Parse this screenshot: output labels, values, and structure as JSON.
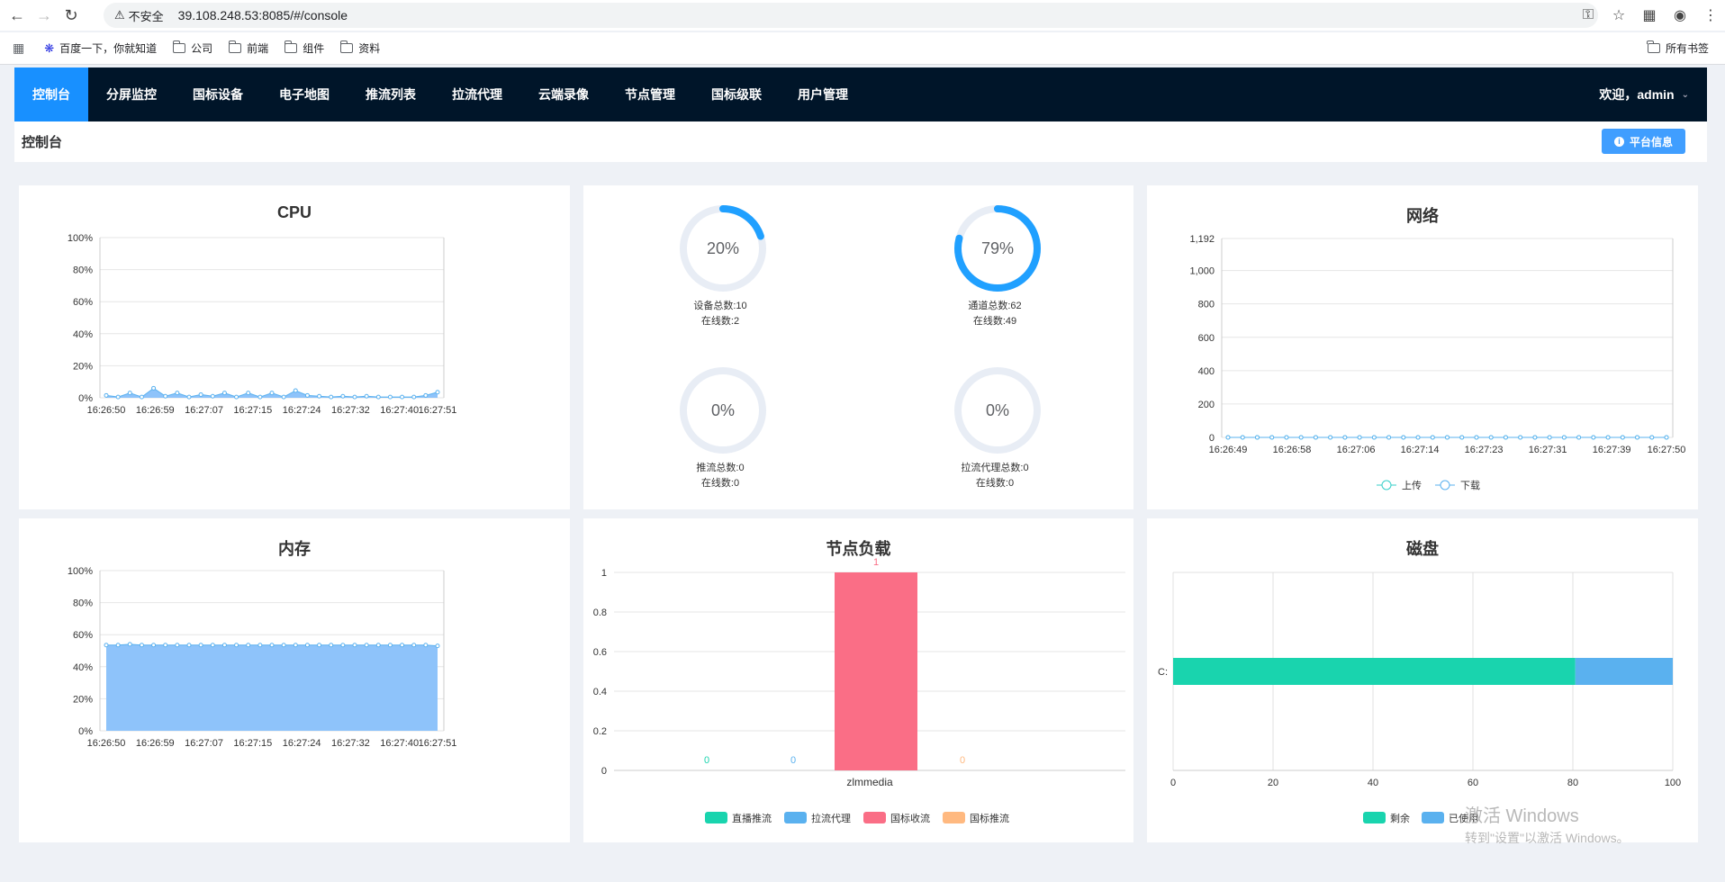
{
  "browser": {
    "security_label": "不安全",
    "url": "39.108.248.53:8085/#/console",
    "bookmarks": [
      "百度一下，你就知道",
      "公司",
      "前端",
      "组件",
      "资料"
    ],
    "all_bookmarks": "所有书签"
  },
  "nav": {
    "items": [
      "控制台",
      "分屏监控",
      "国标设备",
      "电子地图",
      "推流列表",
      "拉流代理",
      "云端录像",
      "节点管理",
      "国标级联",
      "用户管理"
    ],
    "active_index": 0,
    "welcome": "欢迎，admin"
  },
  "page": {
    "title": "控制台",
    "info_button": "平台信息"
  },
  "gauges": [
    {
      "percent_label": "20%",
      "fraction": 0.2,
      "line1": "设备总数:10",
      "line2": "在线数:2"
    },
    {
      "percent_label": "79%",
      "fraction": 0.79,
      "line1": "通道总数:62",
      "line2": "在线数:49"
    },
    {
      "percent_label": "0%",
      "fraction": 0,
      "line1": "推流总数:0",
      "line2": "在线数:0"
    },
    {
      "percent_label": "0%",
      "fraction": 0,
      "line1": "拉流代理总数:0",
      "line2": "在线数:0"
    }
  ],
  "chart_data": [
    {
      "id": "cpu",
      "type": "area",
      "title": "CPU",
      "yticks": [
        "0%",
        "20%",
        "40%",
        "60%",
        "80%",
        "100%"
      ],
      "ylim": [
        0,
        100
      ],
      "xticks": [
        "16:26:50",
        "16:26:59",
        "16:27:07",
        "16:27:15",
        "16:27:24",
        "16:27:32",
        "16:27:40",
        "16:27:51"
      ],
      "values": [
        1.5,
        0.5,
        3,
        0.5,
        6,
        1,
        3,
        0.5,
        2,
        1,
        3,
        0.5,
        3,
        0.5,
        3,
        0.5,
        4.5,
        1.5,
        1,
        0.5,
        1,
        0.5,
        1,
        0.5,
        0.5,
        0.5,
        0.5,
        1.5,
        3.5
      ],
      "grid": true
    },
    {
      "id": "network",
      "type": "line",
      "title": "网络",
      "yticks": [
        "0",
        "200",
        "400",
        "600",
        "800",
        "1,000",
        "1,192"
      ],
      "ylim": [
        0,
        1192
      ],
      "xticks": [
        "16:26:49",
        "16:26:58",
        "16:27:06",
        "16:27:14",
        "16:27:23",
        "16:27:31",
        "16:27:39",
        "16:27:50"
      ],
      "series": [
        {
          "name": "上传",
          "color": "#36cfc9",
          "values": [
            0,
            0,
            0,
            0,
            0,
            0,
            0,
            0,
            0,
            0,
            0,
            0,
            0,
            0,
            0,
            0,
            0,
            0,
            0,
            0,
            0,
            0,
            0,
            0,
            0,
            0,
            0,
            0,
            0,
            0,
            0
          ]
        },
        {
          "name": "下载",
          "color": "#5ab1ef",
          "values": [
            0,
            0,
            0,
            0,
            0,
            0,
            0,
            0,
            0,
            0,
            0,
            0,
            0,
            0,
            0,
            0,
            0,
            0,
            0,
            0,
            0,
            0,
            0,
            0,
            0,
            0,
            0,
            0,
            0,
            0,
            0
          ]
        }
      ],
      "legend_position": "bottom"
    },
    {
      "id": "memory",
      "type": "area",
      "title": "内存",
      "yticks": [
        "0%",
        "20%",
        "40%",
        "60%",
        "80%",
        "100%"
      ],
      "ylim": [
        0,
        100
      ],
      "xticks": [
        "16:26:50",
        "16:26:59",
        "16:27:07",
        "16:27:15",
        "16:27:24",
        "16:27:32",
        "16:27:40",
        "16:27:51"
      ],
      "values": [
        53.5,
        53.5,
        54,
        53.5,
        53.5,
        53.5,
        53.5,
        53.5,
        53.5,
        53.5,
        53.5,
        53.5,
        53.5,
        53.5,
        53.5,
        53.5,
        53.5,
        53.5,
        53.5,
        53.5,
        53.5,
        53.5,
        53.5,
        53.5,
        53.5,
        53.5,
        53.5,
        53.5,
        53
      ],
      "grid": true
    },
    {
      "id": "node-load",
      "type": "bar",
      "title": "节点负载",
      "categories": [
        "zlmmedia"
      ],
      "yticks": [
        "0",
        "0.2",
        "0.4",
        "0.6",
        "0.8",
        "1"
      ],
      "ylim": [
        0,
        1
      ],
      "series": [
        {
          "name": "直播推流",
          "color": "#19d4ae",
          "values": [
            0
          ]
        },
        {
          "name": "拉流代理",
          "color": "#5ab1ef",
          "values": [
            0
          ]
        },
        {
          "name": "国标收流",
          "color": "#fa6e86",
          "values": [
            1
          ]
        },
        {
          "name": "国标推流",
          "color": "#ffb980",
          "values": [
            0
          ]
        }
      ],
      "legend_position": "bottom"
    },
    {
      "id": "disk",
      "type": "bar",
      "orientation": "horizontal",
      "stacked": true,
      "title": "磁盘",
      "categories": [
        "C:"
      ],
      "xticks": [
        "0",
        "20",
        "40",
        "60",
        "80",
        "100"
      ],
      "xlim": [
        0,
        100
      ],
      "series": [
        {
          "name": "剩余",
          "color": "#19d4ae",
          "values": [
            80.5
          ]
        },
        {
          "name": "已使用",
          "color": "#5ab1ef",
          "values": [
            19.5
          ]
        }
      ],
      "legend_position": "bottom"
    }
  ],
  "watermark": {
    "line1": "激活 Windows",
    "line2": "转到\"设置\"以激活 Windows。"
  }
}
